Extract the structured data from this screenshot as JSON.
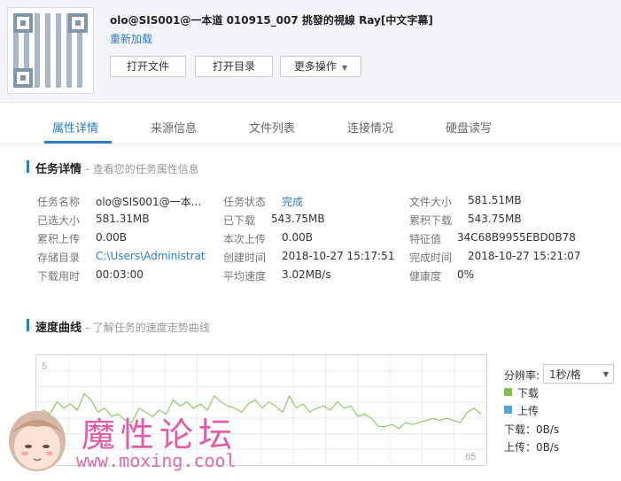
{
  "header": {
    "title": "olo@SIS001@一本道 010915_007 挑發的視線 Ray[中文字幕]",
    "redownload": "重新加载",
    "btn_open_file": "打开文件",
    "btn_open_dir": "打开目录",
    "btn_more": "更多操作"
  },
  "tabs": [
    "属性详情",
    "来源信息",
    "文件列表",
    "连接情况",
    "硬盘读写"
  ],
  "details": {
    "title": "任务详情",
    "subtitle": "- 查看您的任务属性信息",
    "rows": [
      [
        {
          "label": "任务名称",
          "value": "olo@SIS001@一本..."
        },
        {
          "label": "任务状态",
          "value": "完成"
        },
        {
          "label": "文件大小",
          "value": "581.51MB"
        }
      ],
      [
        {
          "label": "已选大小",
          "value": "581.31MB"
        },
        {
          "label": "已下载",
          "value": "543.75MB"
        },
        {
          "label": "累积下载",
          "value": "543.75MB"
        }
      ],
      [
        {
          "label": "累积上传",
          "value": "0.00B"
        },
        {
          "label": "本次上传",
          "value": "0.00B"
        },
        {
          "label": "特征值",
          "value": "34C68B9955EBD0B78..."
        }
      ],
      [
        {
          "label": "存储目录",
          "value": "C:\\Users\\Administrat..."
        },
        {
          "label": "创建时间",
          "value": "2018-10-27 15:17:51"
        },
        {
          "label": "完成时间",
          "value": "2018-10-27 15:21:07"
        }
      ],
      [
        {
          "label": "下载用时",
          "value": "00:03:00"
        },
        {
          "label": "平均速度",
          "value": "3.02MB/s"
        },
        {
          "label": "健康度",
          "value": "0%"
        }
      ]
    ]
  },
  "speed": {
    "title": "速度曲线",
    "subtitle": "- 了解任务的速度走势曲线",
    "resolution_label": "分辨率:",
    "resolution_value": "1秒/格",
    "legend_download": "下载",
    "legend_upload": "上传",
    "download_rate": "下载：0B/s",
    "upload_rate": "上传：0B/s",
    "download_color": "#7dc34a",
    "upload_color": "#4aa8de"
  },
  "chart_data": {
    "type": "line",
    "y_top_label": "5",
    "x_end_label": "65",
    "series": [
      {
        "values": [
          2.1,
          2.5,
          2.3,
          2.9,
          2.6,
          2.8,
          2.5,
          3.3,
          3.0,
          2.4,
          2.6,
          2.2,
          2.3,
          2.0,
          1.9,
          2.6,
          2.4,
          2.2,
          2.5,
          2.3,
          3.0,
          2.7,
          2.9,
          2.6,
          2.8,
          2.5,
          3.2,
          2.9,
          2.7,
          2.6,
          2.4,
          2.8,
          3.0,
          2.6,
          2.9,
          2.7,
          2.4,
          3.2,
          2.6,
          2.8,
          2.4,
          2.6,
          2.7,
          2.5,
          2.9,
          2.6,
          2.7,
          2.2,
          2.3,
          2.1,
          1.7,
          1.7,
          1.8,
          1.6,
          1.9,
          1.8,
          1.9,
          2.0,
          2.1,
          2.0,
          2.1,
          2.0,
          1.9,
          2.4,
          2.6,
          2.3
        ]
      }
    ],
    "ylim": [
      0,
      5
    ],
    "grid": true
  },
  "watermark": {
    "text": "魔性论坛",
    "url": "www.moxing.cool"
  }
}
